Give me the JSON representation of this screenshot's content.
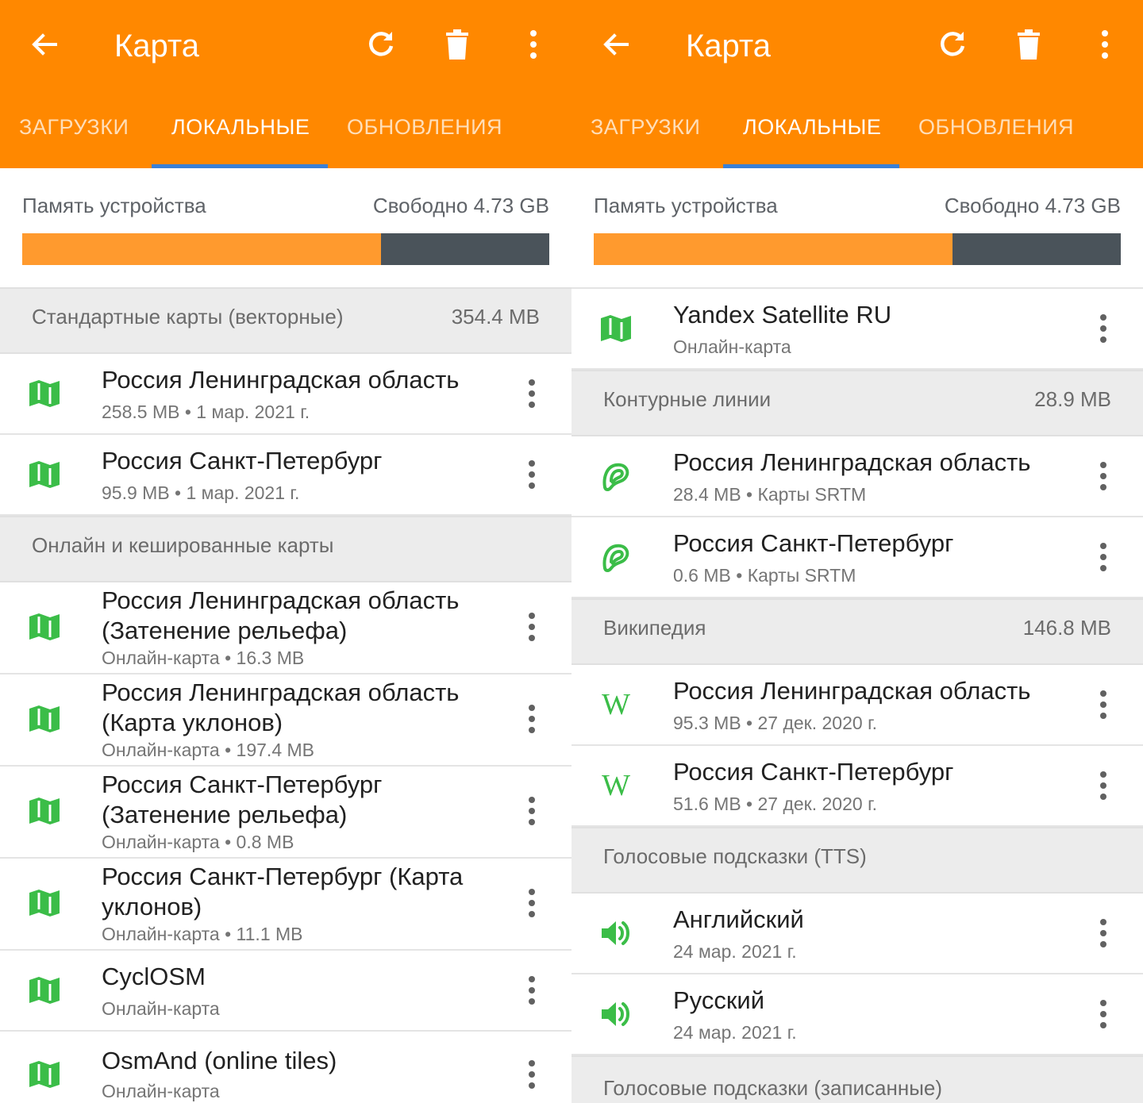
{
  "colors": {
    "accent": "#ff8800",
    "tab_indicator": "#3a80d6",
    "icon_green": "#3bbd48",
    "storage_used": "#ff9a2e",
    "storage_free": "#4a535a"
  },
  "left": {
    "title": "Карта",
    "tabs": [
      "ЗАГРУЗКИ",
      "ЛОКАЛЬНЫЕ",
      "ОБНОВЛЕНИЯ"
    ],
    "selected_tab": 1,
    "storage": {
      "label": "Память устройства",
      "free": "Свободно 4.73 GB",
      "used_fraction": 0.68
    },
    "sections": [
      {
        "title": "Стандартные карты (векторные)",
        "size": "354.4 MB",
        "items": [
          {
            "name": "Россия Ленинградская область",
            "sub": "258.5 MB • 1 мар. 2021 г.",
            "icon": "map-icon"
          },
          {
            "name": "Россия Санкт-Петербург",
            "sub": "95.9 MB • 1 мар. 2021 г.",
            "icon": "map-icon"
          }
        ]
      },
      {
        "title": "Онлайн и кешированные карты",
        "size": "",
        "items": [
          {
            "name": "Россия Ленинградская область (Затенение рельефа)",
            "sub": "Онлайн-карта • 16.3 MB",
            "icon": "map-icon"
          },
          {
            "name": "Россия Ленинградская область (Карта уклонов)",
            "sub": "Онлайн-карта • 197.4 MB",
            "icon": "map-icon"
          },
          {
            "name": "Россия Санкт-Петербург (Затенение рельефа)",
            "sub": "Онлайн-карта • 0.8 MB",
            "icon": "map-icon"
          },
          {
            "name": "Россия Санкт-Петербург (Карта уклонов)",
            "sub": "Онлайн-карта • 11.1 MB",
            "icon": "map-icon"
          },
          {
            "name": "CyclOSM",
            "sub": "Онлайн-карта",
            "icon": "map-icon"
          },
          {
            "name": "OsmAnd (online tiles)",
            "sub": "Онлайн-карта",
            "icon": "map-icon"
          }
        ]
      }
    ]
  },
  "right": {
    "title": "Карта",
    "tabs": [
      "ЗАГРУЗКИ",
      "ЛОКАЛЬНЫЕ",
      "ОБНОВЛЕНИЯ"
    ],
    "selected_tab": 1,
    "storage": {
      "label": "Память устройства",
      "free": "Свободно 4.73 GB",
      "used_fraction": 0.68
    },
    "top_items": [
      {
        "name": "Yandex Satellite RU",
        "sub": "Онлайн-карта",
        "icon": "map-icon"
      }
    ],
    "sections": [
      {
        "title": "Контурные линии",
        "size": "28.9 MB",
        "items": [
          {
            "name": "Россия Ленинградская область",
            "sub": "28.4 MB • Карты SRTM",
            "icon": "contour-lines-icon"
          },
          {
            "name": "Россия Санкт-Петербург",
            "sub": "0.6 MB • Карты SRTM",
            "icon": "contour-lines-icon"
          }
        ]
      },
      {
        "title": "Википедия",
        "size": "146.8 MB",
        "items": [
          {
            "name": "Россия Ленинградская область",
            "sub": "95.3 MB • 27 дек. 2020 г.",
            "icon": "wikipedia-icon"
          },
          {
            "name": "Россия Санкт-Петербург",
            "sub": "51.6 MB • 27 дек. 2020 г.",
            "icon": "wikipedia-icon"
          }
        ]
      },
      {
        "title": "Голосовые подсказки (TTS)",
        "size": "",
        "items": [
          {
            "name": "Английский",
            "sub": "24 мар. 2021 г.",
            "icon": "speaker-icon"
          },
          {
            "name": "Русский",
            "sub": "24 мар. 2021 г.",
            "icon": "speaker-icon"
          }
        ]
      },
      {
        "title": "Голосовые подсказки (записанные)",
        "size": "",
        "items": []
      }
    ]
  }
}
